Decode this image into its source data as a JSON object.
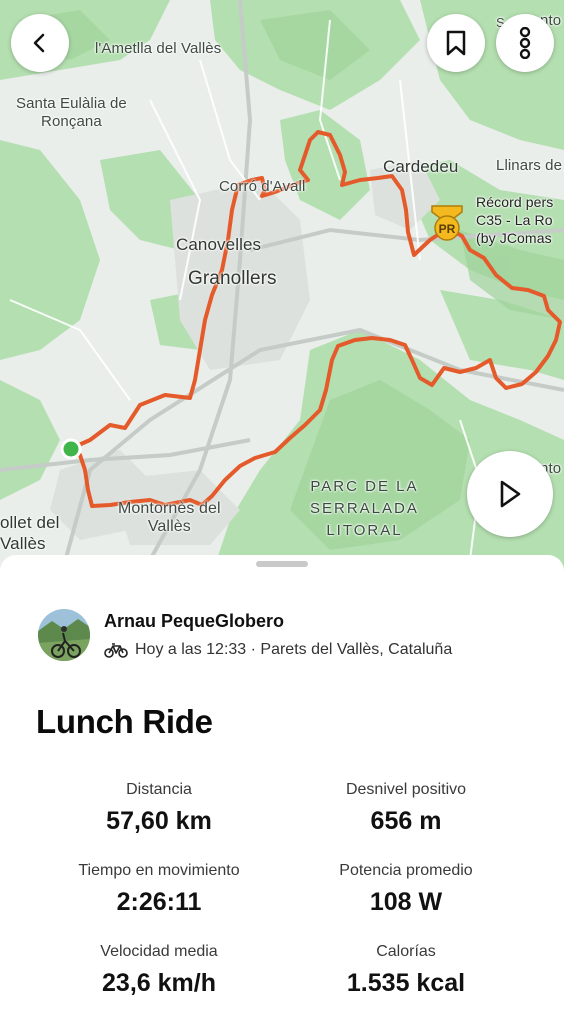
{
  "map": {
    "labels": {
      "ametlla": "l'Ametlla del Vallès",
      "eulalia": "Santa Eulàlia de\nRonçana",
      "corro": "Corró d'Avall",
      "cardedeu": "Cardedeu",
      "llinars": "Llinars de",
      "canovelles": "Canovelles",
      "granollers": "Granollers",
      "montornes": "Montornès del\nVallès",
      "mollet": "ollet del\nVallès",
      "park": "PARC DE LA\nSERRALADA\nLITORAL",
      "segment": "Récord pers\nC35 - La Ro\n(by JComas",
      "sant_top": "S",
      "nto_top": "nto",
      "nto_right": "nto"
    },
    "pr_badge": "PR",
    "colors": {
      "route": "#e55a2b",
      "park": "#a9d8a6",
      "start": "#3fb54a"
    }
  },
  "buttons": {
    "back": "back",
    "bookmark": "bookmark",
    "more": "more",
    "play": "play"
  },
  "athlete": {
    "name": "Arnau PequeGlobero",
    "meta": "Hoy a las 12:33 · Parets del Vallès, Cataluña"
  },
  "activity": {
    "title": "Lunch Ride"
  },
  "stats": [
    {
      "label": "Distancia",
      "value": "57,60 km"
    },
    {
      "label": "Desnivel positivo",
      "value": "656 m"
    },
    {
      "label": "Tiempo en movimiento",
      "value": "2:26:11"
    },
    {
      "label": "Potencia promedio",
      "value": "108 W"
    },
    {
      "label": "Velocidad media",
      "value": "23,6 km/h"
    },
    {
      "label": "Calorías",
      "value": "1.535 kcal"
    }
  ]
}
